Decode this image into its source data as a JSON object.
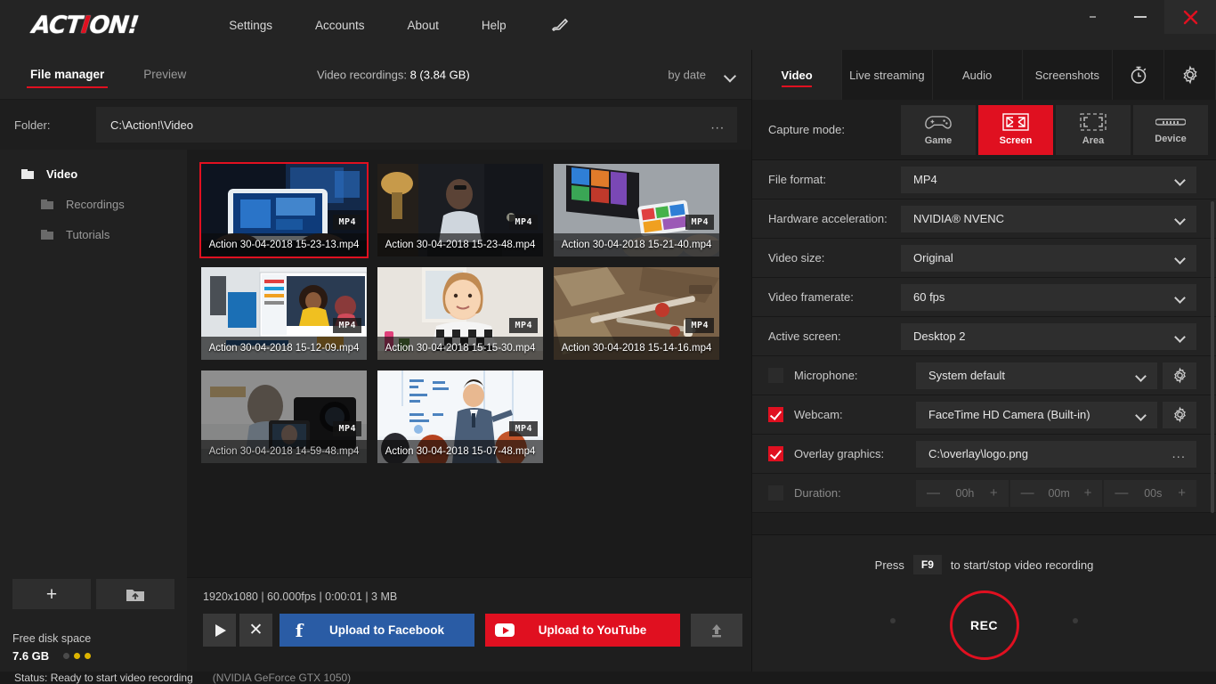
{
  "app": {
    "logo_left": "ACT",
    "logo_i": "I",
    "logo_right": "ON!",
    "nav": [
      {
        "label": "Settings",
        "name": "nav-settings"
      },
      {
        "label": "Accounts",
        "name": "nav-accounts"
      },
      {
        "label": "About",
        "name": "nav-about"
      },
      {
        "label": "Help",
        "name": "nav-help"
      }
    ],
    "pen_icon": "pen-icon",
    "window_controls": {
      "restore": "restore-icon",
      "minimize": "minimize-icon",
      "close": "close-icon"
    }
  },
  "left": {
    "tabs": [
      {
        "label": "File manager",
        "active": true
      },
      {
        "label": "Preview",
        "active": false
      }
    ],
    "recordings_label": "Video recordings:",
    "recordings_value": "8 (3.84 GB)",
    "sort": {
      "label": "by date",
      "icon": "chevron-down-icon"
    },
    "folder": {
      "label": "Folder:",
      "path": "C:\\Action!\\Video",
      "more": "..."
    },
    "tree": [
      {
        "label": "Video",
        "level": 0
      },
      {
        "label": "Recordings",
        "level": 1
      },
      {
        "label": "Tutorials",
        "level": 1
      }
    ],
    "add_buttons": [
      {
        "name": "add-folder-button",
        "icon": "plus-icon"
      },
      {
        "name": "open-folder-button",
        "icon": "folder-up-icon"
      }
    ],
    "disk": {
      "label": "Free disk space",
      "value": "7.6 GB",
      "indicator": [
        false,
        true,
        true
      ]
    },
    "thumbnails": [
      {
        "caption": "Action 30-04-2018 15-23-13.mp4",
        "badge": "MP4",
        "selected": true,
        "dim": false,
        "art": "tablet-hands"
      },
      {
        "caption": "Action 30-04-2018 15-23-48.mp4",
        "badge": "MP4",
        "selected": false,
        "dim": false,
        "art": "man-desk-dark"
      },
      {
        "caption": "Action 30-04-2018 15-21-40.mp4",
        "badge": "MP4",
        "selected": false,
        "dim": false,
        "art": "tiles-phone"
      },
      {
        "caption": "Action 30-04-2018 15-12-09.mp4",
        "badge": "MP4",
        "selected": false,
        "dim": false,
        "art": "office-screen"
      },
      {
        "caption": "Action 30-04-2018 15-15-30.mp4",
        "badge": "MP4",
        "selected": false,
        "dim": false,
        "art": "smiling-woman"
      },
      {
        "caption": "Action 30-04-2018 15-14-16.mp4",
        "badge": "MP4",
        "selected": false,
        "dim": false,
        "art": "workbench"
      },
      {
        "caption": "Action 30-04-2018 14-59-48.mp4",
        "badge": "MP4",
        "selected": false,
        "dim": true,
        "art": "camera-shoot"
      },
      {
        "caption": "Action 30-04-2018 15-07-48.mp4",
        "badge": "MP4",
        "selected": false,
        "dim": false,
        "art": "presenter"
      }
    ],
    "preview": {
      "meta": "1920x1080 | 60.000fps | 0:00:01 | 3 MB",
      "play": "play-icon",
      "delete": "close-icon",
      "facebook_label": "Upload to Facebook",
      "youtube_label": "Upload to YouTube",
      "upload_more": "upload-icon"
    }
  },
  "right": {
    "tabs": [
      {
        "label": "Video",
        "active": true,
        "icon": null
      },
      {
        "label": "Live streaming",
        "active": false,
        "icon": null
      },
      {
        "label": "Audio",
        "active": false,
        "icon": null
      },
      {
        "label": "Screenshots",
        "active": false,
        "icon": null
      },
      {
        "label": "",
        "active": false,
        "icon": "stopwatch-icon"
      },
      {
        "label": "",
        "active": false,
        "icon": "gear-icon"
      }
    ],
    "capture_mode": {
      "label": "Capture mode:",
      "options": [
        {
          "label": "Game",
          "icon": "gamepad-icon",
          "active": false
        },
        {
          "label": "Screen",
          "icon": "fullscreen-icon",
          "active": true
        },
        {
          "label": "Area",
          "icon": "area-icon",
          "active": false
        },
        {
          "label": "Device",
          "icon": "device-icon",
          "active": false
        }
      ]
    },
    "settings": [
      {
        "label": "File format:",
        "value": "MP4",
        "type": "select"
      },
      {
        "label": "Hardware acceleration:",
        "value": "NVIDIA® NVENC",
        "type": "select"
      },
      {
        "label": "Video size:",
        "value": "Original",
        "type": "select"
      },
      {
        "label": "Video framerate:",
        "value": "60 fps",
        "type": "select"
      },
      {
        "label": "Active screen:",
        "value": "Desktop 2",
        "type": "select"
      }
    ],
    "microphone": {
      "label": "Microphone:",
      "value": "System default",
      "checked": false,
      "gear": "gear-icon"
    },
    "webcam": {
      "label": "Webcam:",
      "value": "FaceTime HD Camera (Built-in)",
      "checked": true,
      "gear": "gear-icon"
    },
    "overlay": {
      "label": "Overlay graphics:",
      "value": "C:\\overlay\\logo.png",
      "checked": true,
      "more": "..."
    },
    "duration": {
      "label": "Duration:",
      "checked": false,
      "fields": [
        {
          "minus": "—",
          "value": "00h",
          "plus": "+"
        },
        {
          "minus": "—",
          "value": "00m",
          "plus": "+"
        },
        {
          "minus": "—",
          "value": "00s",
          "plus": "+"
        }
      ]
    },
    "record": {
      "press_prefix": "Press",
      "key": "F9",
      "press_suffix": "to start/stop video recording",
      "button_label": "REC"
    }
  },
  "statusbar": {
    "status": "Status:  Ready to start video recording",
    "gpu": "(NVIDIA GeForce GTX 1050)"
  },
  "colors": {
    "accent_red": "#e01020",
    "facebook_blue": "#2a5ca5",
    "youtube_red": "#e01020",
    "panel_bg": "#1e1e1e",
    "titlebar_bg": "#242424"
  }
}
